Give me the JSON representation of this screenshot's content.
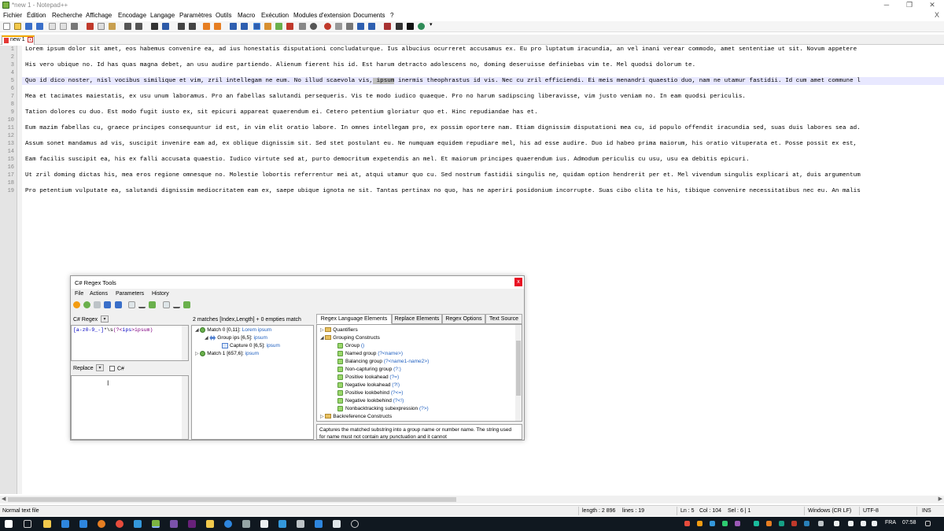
{
  "window": {
    "title": "*new 1 - Notepad++",
    "controls": [
      "─",
      "❐",
      "✕"
    ]
  },
  "menu": [
    "Fichier",
    "Édition",
    "Recherche",
    "Affichage",
    "Encodage",
    "Langage",
    "Paramètres",
    "Outils",
    "Macro",
    "Exécution",
    "Modules d'extension",
    "Documents",
    "?"
  ],
  "menu_close": "X",
  "tab": {
    "label": "new 1",
    "close": "x"
  },
  "editor": {
    "line_numbers": [
      "1",
      "2",
      "3",
      "4",
      "5",
      "6",
      "7",
      "8",
      "9",
      "10",
      "11",
      "12",
      "13",
      "14",
      "15",
      "16",
      "17",
      "18",
      "19"
    ],
    "lines": [
      "Lorem ipsum dolor sit amet, eos habemus convenire ea, ad ius honestatis disputationi concludaturque. Ius albucius ocurreret accusamus ex. Eu pro luptatum iracundia, an vel inani verear commodo, amet sententiae ut sit. Novum appetere",
      "",
      "His vero ubique no. Id has quas magna debet, an usu audire partiendo. Alienum fierent his id. Est harum detracto adolescens no, doming deseruisse definiebas vim te. Mel quodsi dolorum te.",
      "",
      "Quo id dico noster, nisl vocibus similique et vim, zril intellegam ne eum. No illud scaevola vis, ipsum inermis theophrastus id vis. Nec cu zril efficiendi. Ei meis menandri quaestio duo, nam ne utamur fastidii. Id cum amet commune l",
      "",
      "Mea et tacimates maiestatis, ex usu unum laboramus. Pro an fabellas salutandi persequeris. Vis te modo iudico quaeque. Pro no harum sadipscing liberavisse, vim justo veniam no. In eam quodsi periculis.",
      "",
      "Tation dolores cu duo. Est modo fugit iusto ex, sit epicuri appareat quaerendum ei. Cetero petentium gloriatur quo et. Hinc repudiandae has et.",
      "",
      "Eum mazim fabellas cu, graece principes consequuntur id est, in vim elit oratio labore. In omnes intellegam pro, ex possim oportere nam. Etiam dignissim disputationi mea cu, id populo offendit iracundia sed, suas duis labores sea ad.",
      "",
      "Assum sonet mandamus ad vis, suscipit invenire eam ad, ex oblique dignissim sit. Sed stet postulant eu. Ne numquam equidem repudiare mel, his ad esse audire. Duo id habeo prima maiorum, his oratio vituperata et. Posse possit ex est,",
      "",
      "Eam facilis suscipit ea, his ex falli accusata quaestio. Iudico virtute sed at, purto democritum expetendis an mel. Et maiorum principes quaerendum ius. Admodum periculis cu usu, usu ea debitis epicuri.",
      "",
      "Ut zril doming dictas his, mea eros regione omnesque no. Molestie lobortis referrentur mei at, atqui utamur quo cu. Sed nostrum fastidii singulis ne, quidam option hendrerit per et. Mel vivendum singulis explicari at, duis argumentum",
      "",
      "Pro petentium vulputate ea, salutandi dignissim mediocritatem eam ex, saepe ubique ignota ne sit. Tantas pertinax no quo, has ne aperiri posidonium incorrupte. Suas cibo clita te his, tibique convenire necessitatibus nec eu. An malis"
    ],
    "line5": {
      "before": "Quo id dico noster, nisl vocibus similique et vim, zril intellegam ne eum. No illud scaevola vis,",
      "match": " ipsum",
      "after": " inermis theophrastus id vis. Nec cu zril efficiendi. Ei meis menandri quaestio duo, nam ne utamur fastidii. Id cum amet commune l"
    }
  },
  "statusbar": {
    "file_type": "Normal text file",
    "length": "length : 2 896",
    "lines": "lines : 19",
    "ln": "Ln : 5",
    "col": "Col : 104",
    "sel": "Sel : 6 | 1",
    "eol": "Windows (CR LF)",
    "encoding": "UTF-8",
    "mode": "INS"
  },
  "taskbar": {
    "lang": "FRA",
    "time": "07:58"
  },
  "regex_dialog": {
    "title": "C# Regex Tools",
    "close": "x",
    "menu": [
      "File",
      "Actions",
      "Parameters",
      "History"
    ],
    "regex_label": "C# Regex",
    "regex_parts": {
      "p1": "[a-z0-9_-]",
      "p2": "*\\s",
      "p3": "(?<",
      "p4": "ips",
      "p5": ">ipsum)"
    },
    "replace_label": "Replace",
    "csharp_label": "C#",
    "matches_summary": "2 matches [Index,Length] + 0 empties match",
    "tree": {
      "match0_label": "Match 0 [0,11]:",
      "match0_value": "Lorem ipsum",
      "group_label": "Group ips [6,5]:",
      "group_value": "ipsum",
      "capture_label": "Capture 0 [6,5]:",
      "capture_value": "ipsum",
      "match1_label": "Match 1 [657,6]:",
      "match1_value": "ipsum"
    },
    "tabs": [
      "Regex Language Elements",
      "Replace Elements",
      "Regex Options",
      "Text Source"
    ],
    "elements": {
      "quantifiers": "Quantifiers",
      "grouping": "Grouping Constructs",
      "items": [
        {
          "label": "Group",
          "syntax": "()"
        },
        {
          "label": "Named group",
          "syntax": "(?<name>)"
        },
        {
          "label": "Balancing group",
          "syntax": "(?<name1-name2>)"
        },
        {
          "label": "Non-capturing group",
          "syntax": "(?:)"
        },
        {
          "label": "Positive lookahead",
          "syntax": "(?=)"
        },
        {
          "label": "Negative lookahead",
          "syntax": "(?!)"
        },
        {
          "label": "Positive lookbehind",
          "syntax": "(?<=)"
        },
        {
          "label": "Negative lookbehind",
          "syntax": "(?<!)"
        },
        {
          "label": "Nonbacktracking subexpression",
          "syntax": "(?>)"
        }
      ],
      "backreference": "Backreference Constructs"
    },
    "description": "Captures the matched substring into a group name or number name. The string used for name must not contain any punctuation and it cannot"
  },
  "colors": {
    "selection_highlight": "#e8e8ff",
    "match_highlight": "#c0c0c0",
    "tab_accent": "#f4a900",
    "close_red": "#e81123",
    "taskbar_bg": "#101820"
  }
}
